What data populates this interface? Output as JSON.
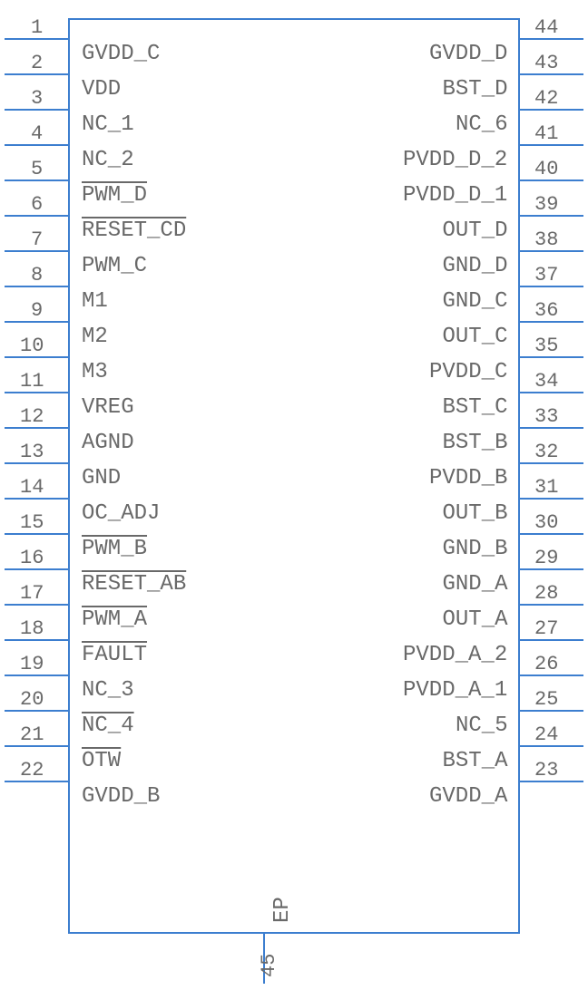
{
  "leftPins": [
    {
      "num": "1",
      "label": "GVDD_C",
      "overline": false
    },
    {
      "num": "2",
      "label": "VDD",
      "overline": false
    },
    {
      "num": "3",
      "label": "NC_1",
      "overline": false
    },
    {
      "num": "4",
      "label": "NC_2",
      "overline": false
    },
    {
      "num": "5",
      "label": "PWM_D",
      "overline": true
    },
    {
      "num": "6",
      "label": "RESET_CD",
      "overline": true
    },
    {
      "num": "7",
      "label": "PWM_C",
      "overline": false
    },
    {
      "num": "8",
      "label": "M1",
      "overline": false
    },
    {
      "num": "9",
      "label": "M2",
      "overline": false
    },
    {
      "num": "10",
      "label": "M3",
      "overline": false
    },
    {
      "num": "11",
      "label": "VREG",
      "overline": false
    },
    {
      "num": "12",
      "label": "AGND",
      "overline": false
    },
    {
      "num": "13",
      "label": "GND",
      "overline": false
    },
    {
      "num": "14",
      "label": "OC_ADJ",
      "overline": false
    },
    {
      "num": "15",
      "label": "PWM_B",
      "overline": true
    },
    {
      "num": "16",
      "label": "RESET_AB",
      "overline": true
    },
    {
      "num": "17",
      "label": "PWM_A",
      "overline": true
    },
    {
      "num": "18",
      "label": "FAULT",
      "overline": true
    },
    {
      "num": "19",
      "label": "NC_3",
      "overline": false
    },
    {
      "num": "20",
      "label": "NC_4",
      "overline": true
    },
    {
      "num": "21",
      "label": "OTW",
      "overline": true
    },
    {
      "num": "22",
      "label": "GVDD_B",
      "overline": false
    }
  ],
  "rightPins": [
    {
      "num": "44",
      "label": "GVDD_D",
      "overline": false
    },
    {
      "num": "43",
      "label": "BST_D",
      "overline": false
    },
    {
      "num": "42",
      "label": "NC_6",
      "overline": false
    },
    {
      "num": "41",
      "label": "PVDD_D_2",
      "overline": false
    },
    {
      "num": "40",
      "label": "PVDD_D_1",
      "overline": false
    },
    {
      "num": "39",
      "label": "OUT_D",
      "overline": false
    },
    {
      "num": "38",
      "label": "GND_D",
      "overline": false
    },
    {
      "num": "37",
      "label": "GND_C",
      "overline": false
    },
    {
      "num": "36",
      "label": "OUT_C",
      "overline": false
    },
    {
      "num": "35",
      "label": "PVDD_C",
      "overline": false
    },
    {
      "num": "34",
      "label": "BST_C",
      "overline": false
    },
    {
      "num": "33",
      "label": "BST_B",
      "overline": false
    },
    {
      "num": "32",
      "label": "PVDD_B",
      "overline": false
    },
    {
      "num": "31",
      "label": "OUT_B",
      "overline": false
    },
    {
      "num": "30",
      "label": "GND_B",
      "overline": false
    },
    {
      "num": "29",
      "label": "GND_A",
      "overline": false
    },
    {
      "num": "28",
      "label": "OUT_A",
      "overline": false
    },
    {
      "num": "27",
      "label": "PVDD_A_2",
      "overline": false
    },
    {
      "num": "26",
      "label": "PVDD_A_1",
      "overline": false
    },
    {
      "num": "25",
      "label": "NC_5",
      "overline": false
    },
    {
      "num": "24",
      "label": "BST_A",
      "overline": false
    },
    {
      "num": "23",
      "label": "GVDD_A",
      "overline": false
    }
  ],
  "bottomPin": {
    "num": "45",
    "label": "EP"
  }
}
